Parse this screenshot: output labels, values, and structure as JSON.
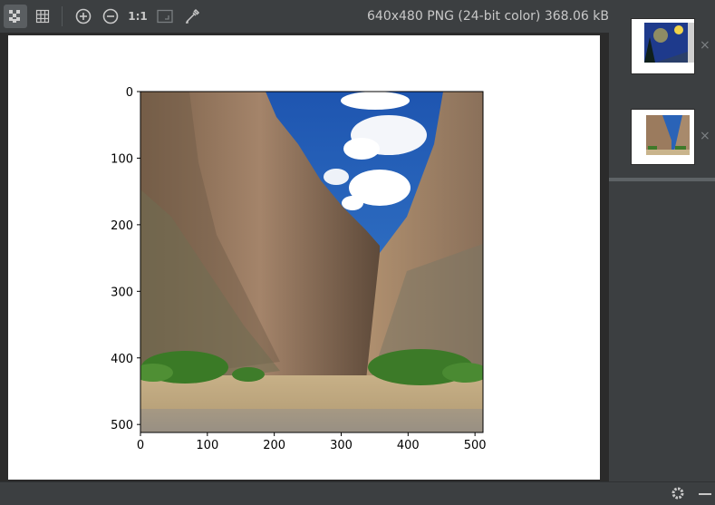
{
  "toolbar": {
    "buttons": [
      {
        "icon": "checkerboard-icon",
        "active": true
      },
      {
        "icon": "grid-icon",
        "active": false
      },
      {
        "icon": "zoom-in-icon",
        "active": false
      },
      {
        "icon": "zoom-out-icon",
        "active": false
      },
      {
        "icon": "actual-size-icon",
        "active": false
      },
      {
        "icon": "fit-to-window-icon",
        "active": false
      },
      {
        "icon": "color-picker-icon",
        "active": false
      }
    ],
    "actual_size_label": "1:1"
  },
  "image_info": "640x480 PNG (24-bit color) 368.06 kB",
  "plot": {
    "x_ticks": [
      "0",
      "100",
      "200",
      "300",
      "400",
      "500"
    ],
    "y_ticks": [
      "0",
      "100",
      "200",
      "300",
      "400",
      "500"
    ]
  },
  "sidebar": {
    "thumbnails": [
      {
        "name": "starry-night-thumbnail",
        "close": "×"
      },
      {
        "name": "canyon-plot-thumbnail",
        "close": "×"
      }
    ]
  },
  "colors": {
    "toolbar_bg": "#3c3f41",
    "canvas_bg": "#2b2b2b",
    "sky": "#2a63b7",
    "rock": "#9b7b5e",
    "sand": "#c9b48c",
    "grass": "#3f7a2a"
  }
}
